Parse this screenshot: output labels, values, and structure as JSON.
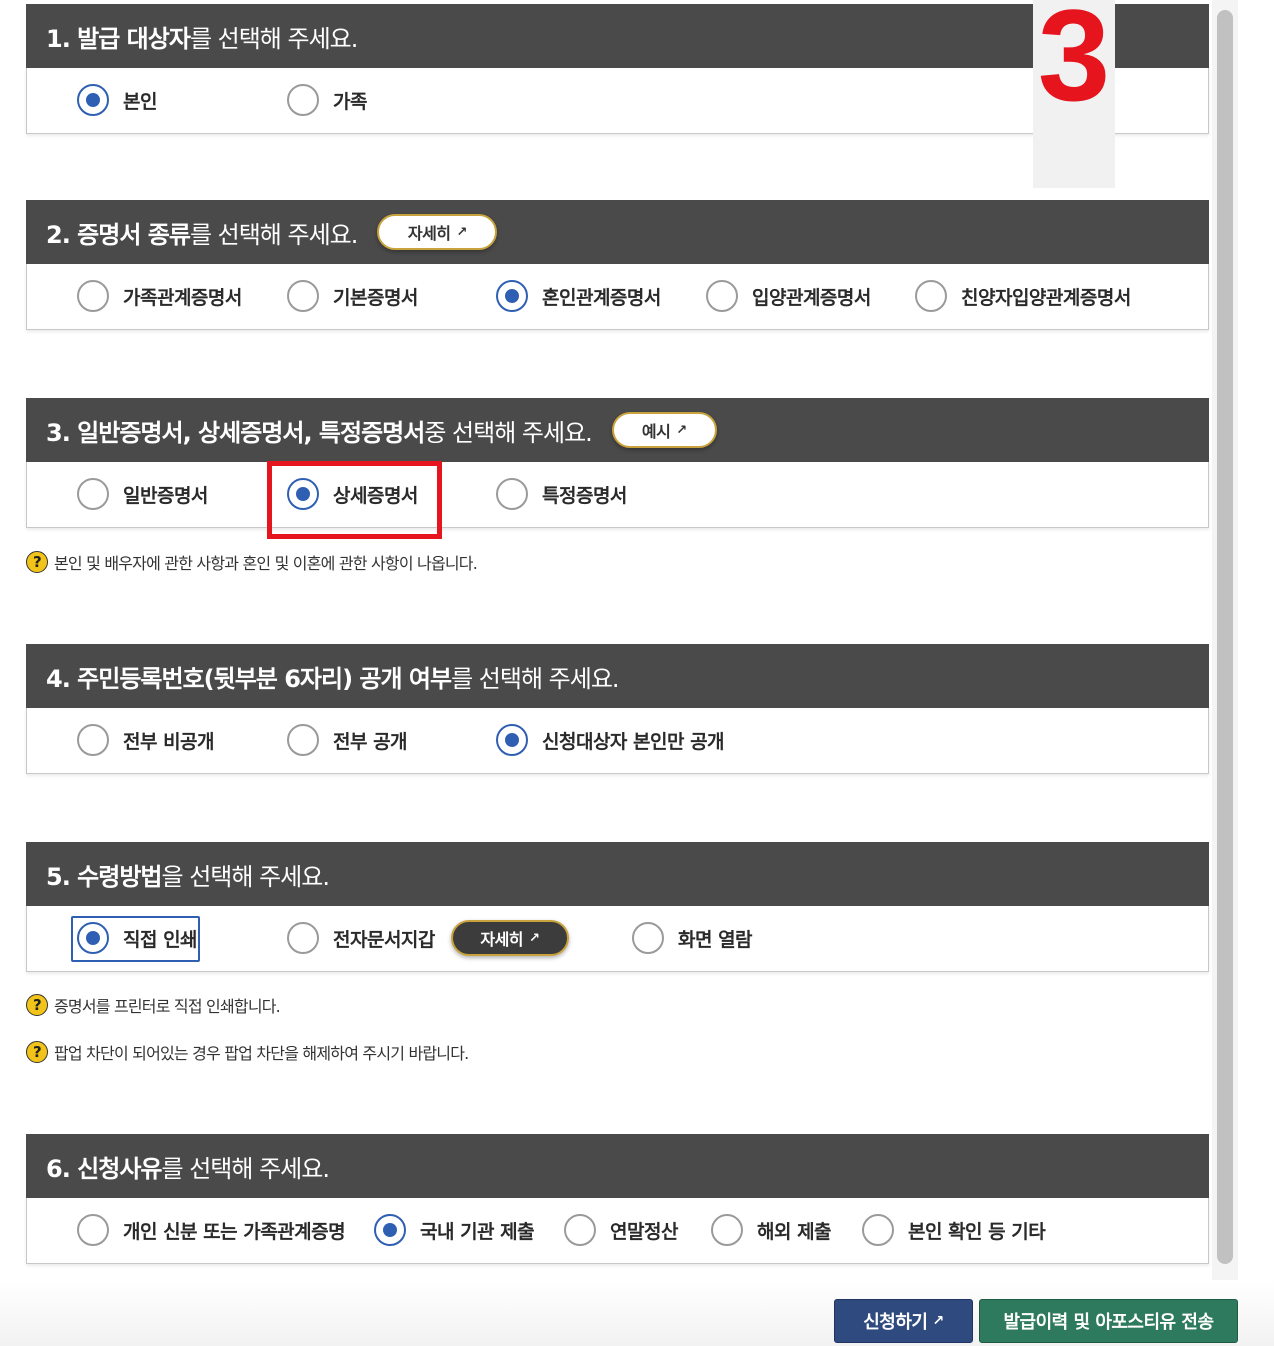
{
  "step_marker": "3",
  "sections": [
    {
      "title_bold": "1. 발급 대상자",
      "title_rest": "를 선택해 주세요.",
      "options": [
        {
          "label": "본인",
          "selected": true
        },
        {
          "label": "가족",
          "selected": false
        }
      ]
    },
    {
      "title_bold": "2. 증명서 종류",
      "title_rest": "를 선택해 주세요.",
      "pill": "자세히",
      "options": [
        {
          "label": "가족관계증명서",
          "selected": false
        },
        {
          "label": "기본증명서",
          "selected": false
        },
        {
          "label": "혼인관계증명서",
          "selected": true
        },
        {
          "label": "입양관계증명서",
          "selected": false
        },
        {
          "label": "친양자입양관계증명서",
          "selected": false
        }
      ]
    },
    {
      "title_bold": "3. 일반증명서, 상세증명서, 특정증명서",
      "title_rest": " 중 선택해 주세요.",
      "pill": "예시",
      "options": [
        {
          "label": "일반증명서",
          "selected": false
        },
        {
          "label": "상세증명서",
          "selected": true
        },
        {
          "label": "특정증명서",
          "selected": false
        }
      ],
      "note": "본인 및 배우자에 관한 사항과 혼인 및 이혼에 관한 사항이 나옵니다."
    },
    {
      "title_bold": "4. 주민등록번호(뒷부분 6자리) 공개 여부",
      "title_rest": "를 선택해 주세요.",
      "options": [
        {
          "label": "전부 비공개",
          "selected": false
        },
        {
          "label": "전부 공개",
          "selected": false
        },
        {
          "label": "신청대상자 본인만 공개",
          "selected": true
        }
      ]
    },
    {
      "title_bold": "5. 수령방법",
      "title_rest": "을 선택해 주세요.",
      "options": [
        {
          "label": "직접 인쇄",
          "selected": true
        },
        {
          "label": "전자문서지갑",
          "selected": false,
          "pill": "자세히"
        },
        {
          "label": "화면 열람",
          "selected": false
        }
      ],
      "notes": [
        "증명서를 프린터로 직접 인쇄합니다.",
        "팝업 차단이 되어있는 경우 팝업 차단을 해제하여 주시기 바랍니다."
      ]
    },
    {
      "title_bold": "6. 신청사유",
      "title_rest": "를 선택해 주세요.",
      "options": [
        {
          "label": "개인 신분 또는 가족관계증명",
          "selected": false
        },
        {
          "label": "국내 기관 제출",
          "selected": true
        },
        {
          "label": "연말정산",
          "selected": false
        },
        {
          "label": "해외 제출",
          "selected": false
        },
        {
          "label": "본인 확인 등 기타",
          "selected": false
        }
      ]
    }
  ],
  "buttons": {
    "apply": "신청하기",
    "send": "발급이력 및 아포스티유 전송"
  },
  "icons": {
    "external_link": "external-link-icon",
    "help": "question-mark-icon"
  },
  "colors": {
    "header_bg": "#4a4a4a",
    "radio_selected": "#2f5fb3",
    "highlight": "#e5141d",
    "apply_button": "#2f4a7f",
    "send_button": "#2e7a5e"
  }
}
